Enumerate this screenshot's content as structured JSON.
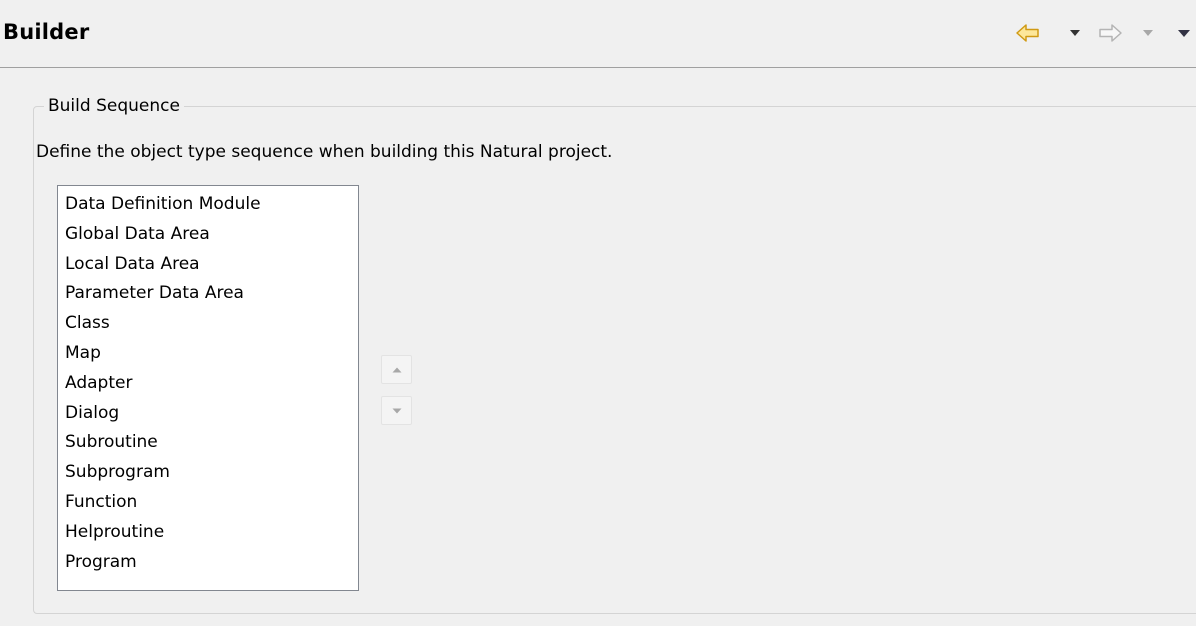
{
  "header": {
    "title": "Builder",
    "icons": [
      "back-arrow-icon",
      "dropdown-triangle-icon",
      "forward-arrow-icon",
      "dropdown-triangle-icon",
      "view-menu-icon"
    ]
  },
  "build_sequence": {
    "group_label": "Build Sequence",
    "description": "Define the object type sequence when building this Natural project.",
    "items": [
      "Data Definition Module",
      "Global Data Area",
      "Local Data Area",
      "Parameter Data Area",
      "Class",
      "Map",
      "Adapter",
      "Dialog",
      "Subroutine",
      "Subprogram",
      "Function",
      "Helproutine",
      "Program"
    ],
    "move_icons": [
      "move-up-icon",
      "move-down-icon"
    ]
  },
  "colors": {
    "background": "#f0f0f0",
    "back_arrow_fill": "#fde79a",
    "back_arrow_stroke": "#d09a14",
    "disabled": "#a8a8a8"
  }
}
